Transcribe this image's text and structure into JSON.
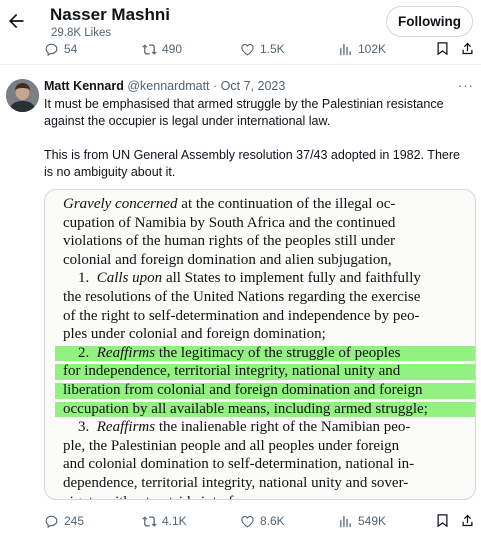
{
  "header": {
    "name": "Nasser Mashni",
    "likes": "29.8K Likes",
    "follow_label": "Following"
  },
  "top_actions": {
    "replies": "54",
    "reposts": "490",
    "likes": "1.5K",
    "views": "102K"
  },
  "tweet": {
    "author_name": "Matt Kennard",
    "author_handle": "@kennardmatt",
    "separator": "·",
    "date": "Oct 7, 2023",
    "more": "···",
    "paragraph_1_line_1": "It must be emphasised that armed struggle by the Palestinian resistance",
    "paragraph_1_line_2": "against the occupier is legal under international law.",
    "paragraph_2_line_1": "This is from UN General Assembly resolution 37/43 adopted in 1982. There",
    "paragraph_2_line_2": "is no ambiguity about it."
  },
  "document": {
    "lines": [
      {
        "italic": "Gravely concerned",
        "text": " at the continuation of the illegal oc-",
        "highlight": false
      },
      {
        "italic": "",
        "text": "cupation of Namibia by South Africa and the continued",
        "highlight": false
      },
      {
        "italic": "",
        "text": "violations of the human rights of the peoples still under",
        "highlight": false
      },
      {
        "italic": "",
        "text": "colonial and foreign domination and alien subjugation,",
        "highlight": false
      },
      {
        "prefix": "    1.  ",
        "italic": "Calls upon",
        "text": " all States to implement fully and faithfully",
        "highlight": false
      },
      {
        "italic": "",
        "text": "the resolutions of the United Nations regarding the exercise",
        "highlight": false
      },
      {
        "italic": "",
        "text": "of the right to self-determination and independence by peo-",
        "highlight": false
      },
      {
        "italic": "",
        "text": "ples under colonial and foreign domination;",
        "highlight": false
      },
      {
        "prefix": "    2.  ",
        "italic": "Reaffirms",
        "text": " the legitimacy of the struggle of peoples",
        "highlight": true
      },
      {
        "italic": "",
        "text": "for independence, territorial integrity, national unity and",
        "highlight": true
      },
      {
        "italic": "",
        "text": "liberation from colonial and foreign domination and foreign",
        "highlight": true
      },
      {
        "italic": "",
        "text": "occupation by all available means, including armed struggle;",
        "highlight": true
      },
      {
        "prefix": "    3.  ",
        "italic": "Reaffirms",
        "text": " the inalienable right of the Namibian peo-",
        "highlight": false
      },
      {
        "italic": "",
        "text": "ple, the Palestinian people and all peoples under foreign",
        "highlight": false
      },
      {
        "italic": "",
        "text": "and colonial domination to self-determination, national in-",
        "highlight": false
      },
      {
        "italic": "",
        "text": "dependence, territorial integrity, national unity and sover-",
        "highlight": false
      },
      {
        "italic": "",
        "text": "eignty without outside interference;",
        "highlight": false
      }
    ]
  },
  "bottom_actions": {
    "replies": "245",
    "reposts": "4.1K",
    "likes": "8.6K",
    "views": "549K"
  },
  "colors": {
    "text": "#0f1419",
    "secondary": "#536471",
    "highlight": "#7ff06b",
    "border": "#cfd9de"
  }
}
